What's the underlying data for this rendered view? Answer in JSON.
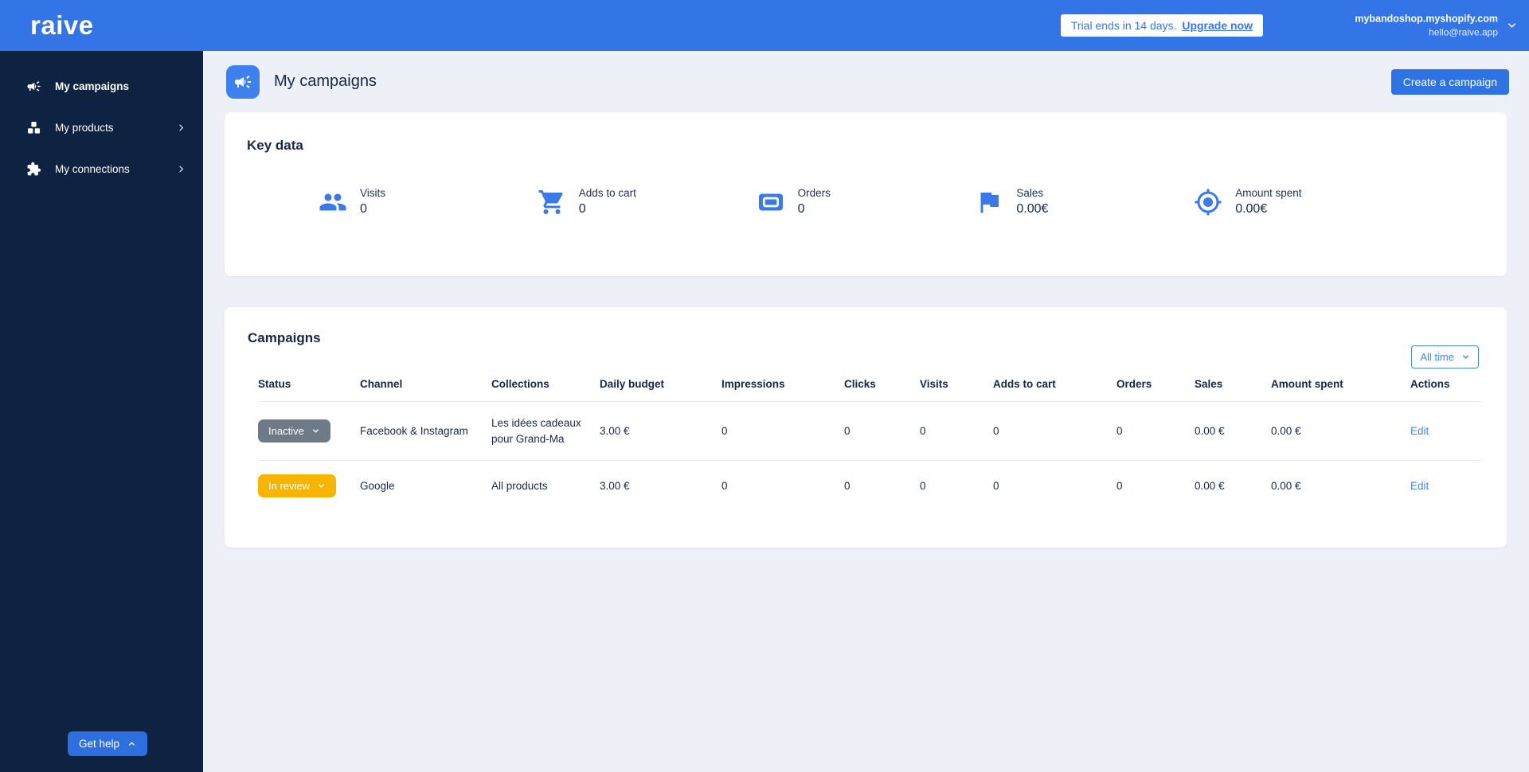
{
  "topbar": {
    "logo": "raive",
    "trial": {
      "text": "Trial ends in 14 days.",
      "link_label": "Upgrade now"
    },
    "account": {
      "shop": "mybandoshop.myshopify.com",
      "email": "hello@raive.app"
    }
  },
  "sidebar": {
    "items": [
      {
        "label": "My campaigns"
      },
      {
        "label": "My products"
      },
      {
        "label": "My connections"
      }
    ],
    "get_help_label": "Get help"
  },
  "page_header": {
    "title": "My campaigns",
    "create_button": "Create a campaign"
  },
  "key_data": {
    "title": "Key data",
    "stats": [
      {
        "label": "Visits",
        "value": "0",
        "icon": "people-icon"
      },
      {
        "label": "Adds to cart",
        "value": "0",
        "icon": "cart-icon"
      },
      {
        "label": "Orders",
        "value": "0",
        "icon": "ticket-icon"
      },
      {
        "label": "Sales",
        "value": "0.00€",
        "icon": "flag-icon"
      },
      {
        "label": "Amount spent",
        "value": "0.00€",
        "icon": "target-icon"
      }
    ]
  },
  "campaigns": {
    "title": "Campaigns",
    "time_filter": "All time",
    "columns": [
      "Status",
      "Channel",
      "Collections",
      "Daily budget",
      "Impressions",
      "Clicks",
      "Visits",
      "Adds to cart",
      "Orders",
      "Sales",
      "Amount spent",
      "Actions"
    ],
    "rows": [
      {
        "status": "Inactive",
        "channel": "Facebook & Instagram",
        "collections": "Les idées cadeaux pour Grand-Ma",
        "daily_budget": "3.00 €",
        "impressions": "0",
        "clicks": "0",
        "visits": "0",
        "adds_to_cart": "0",
        "orders": "0",
        "sales": "0.00 €",
        "amount_spent": "0.00 €",
        "action": "Edit"
      },
      {
        "status": "In review",
        "channel": "Google",
        "collections": "All products",
        "daily_budget": "3.00 €",
        "impressions": "0",
        "clicks": "0",
        "visits": "0",
        "adds_to_cart": "0",
        "orders": "0",
        "sales": "0.00 €",
        "amount_spent": "0.00 €",
        "action": "Edit"
      }
    ]
  },
  "colors": {
    "topbar_blue": "#3375e7",
    "sidebar_navy": "#0e2342",
    "primary_blue": "#2f72e4",
    "accent_blue": "#4285f4",
    "icon_blue": "#3b78e8",
    "page_bg": "#edf0f7",
    "dark_text": "#16284a",
    "badge_inactive": "#6e7a85",
    "badge_in_review": "#f7b501"
  }
}
